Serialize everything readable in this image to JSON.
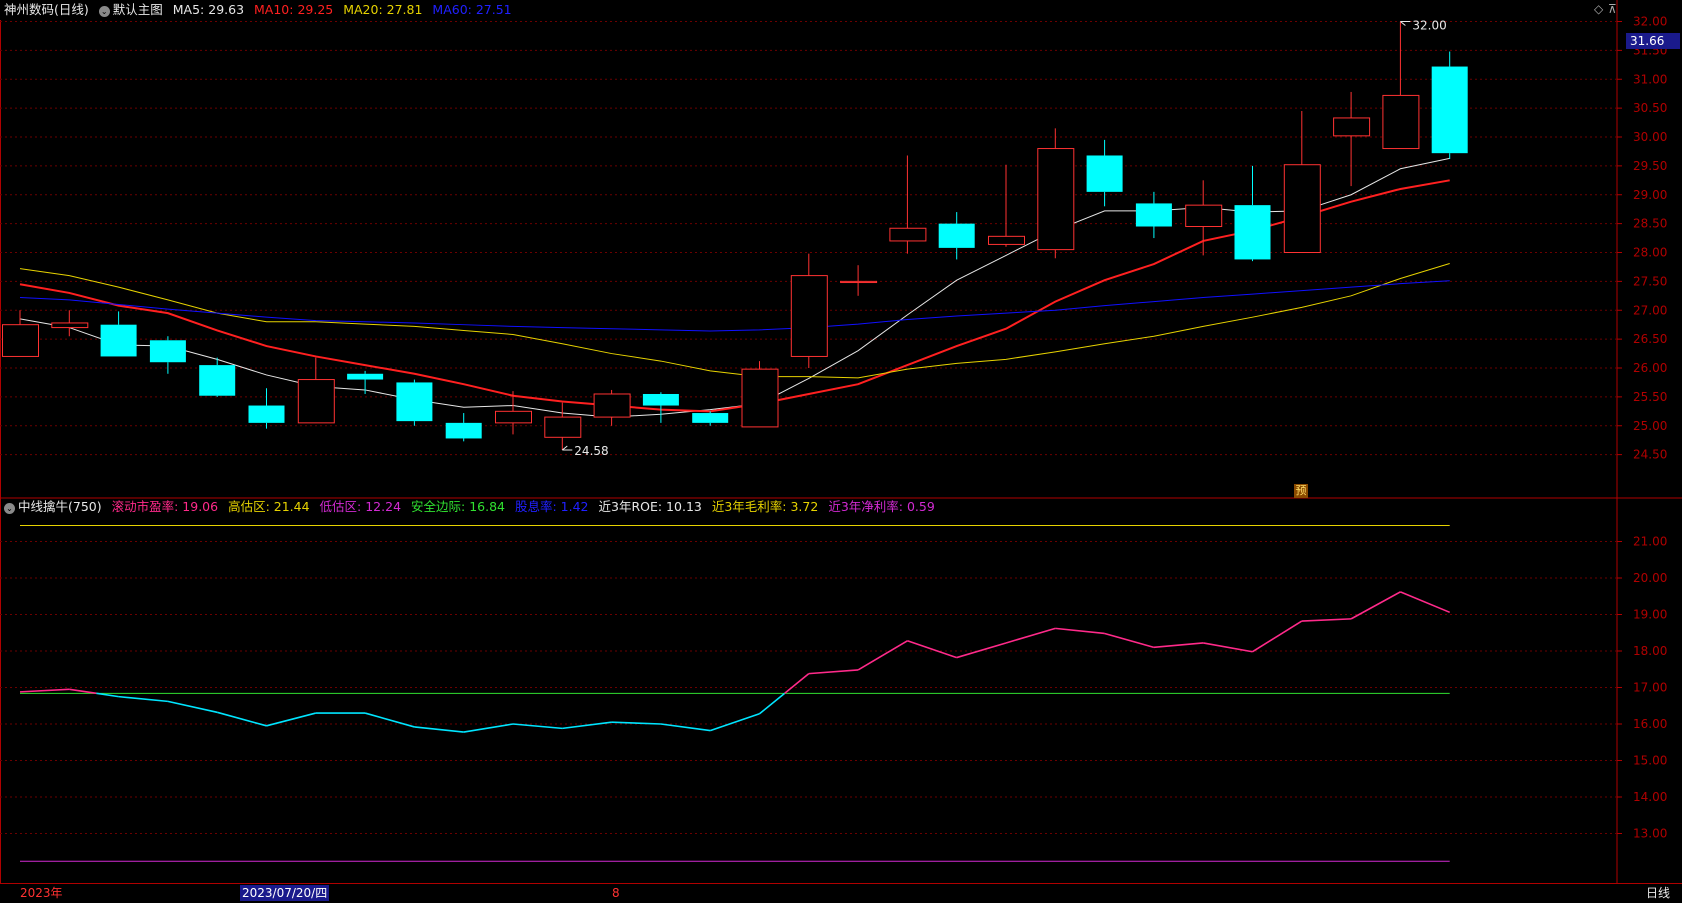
{
  "colors": {
    "grid": "#6b0000",
    "axis": "#b00000",
    "up": "#ff3232",
    "down": "#00ffff",
    "ma5": "#e6e6e6",
    "ma10": "#ff2020",
    "ma20": "#e6d200",
    "ma60": "#1010ff",
    "price_tag_bg": "#1a1a8c"
  },
  "main_header": {
    "stock_name": "神州数码",
    "period_label": "(日线)",
    "chart_menu_label": "默认主图",
    "ma5_label": "MA5: 29.63",
    "ma10_label": "MA10: 29.25",
    "ma20_label": "MA20: 27.81",
    "ma60_label": "MA60: 27.51"
  },
  "sub_header": {
    "indicator_label": "中线擒牛(750)",
    "pe_label": "滚动市盈率: 19.06",
    "high_label": "高估区: 21.44",
    "low_label": "低估区: 12.24",
    "safety_label": "安全边际: 16.84",
    "dividend_label": "股息率: 1.42",
    "roe_label": "近3年ROE: 10.13",
    "gross_label": "近3年毛利率: 3.72",
    "net_label": "近3年净利率: 0.59"
  },
  "bottom_bar": {
    "year_label": "2023年",
    "date_label": "2023/07/20/四",
    "month_label": "8",
    "period_button": "日线"
  },
  "main_axis_labels": [
    "32.00",
    "31.50",
    "31.00",
    "30.50",
    "30.00",
    "29.50",
    "29.00",
    "28.50",
    "28.00",
    "27.50",
    "27.00",
    "26.50",
    "26.00",
    "25.50",
    "25.00",
    "24.50"
  ],
  "sub_axis_labels": [
    "21.00",
    "20.00",
    "19.00",
    "18.00",
    "17.00",
    "16.00",
    "15.00",
    "14.00",
    "13.00"
  ],
  "current_price_tag": "31.66",
  "high_marker": "32.00",
  "low_marker": "24.58",
  "forecast_badge": "预",
  "chart_data": [
    {
      "type": "candlestick",
      "title": "神州数码 (日线)",
      "ylim": [
        24.2,
        32.2
      ],
      "candles": [
        {
          "o": 26.2,
          "h": 27.0,
          "l": 26.2,
          "c": 26.75
        },
        {
          "o": 26.7,
          "h": 27.0,
          "l": 26.55,
          "c": 26.78
        },
        {
          "o": 26.75,
          "h": 26.98,
          "l": 26.2,
          "c": 26.2
        },
        {
          "o": 26.48,
          "h": 26.55,
          "l": 25.9,
          "c": 26.1
        },
        {
          "o": 26.05,
          "h": 26.18,
          "l": 25.5,
          "c": 25.52
        },
        {
          "o": 25.35,
          "h": 25.65,
          "l": 24.95,
          "c": 25.05
        },
        {
          "o": 25.05,
          "h": 26.18,
          "l": 25.05,
          "c": 25.8
        },
        {
          "o": 25.9,
          "h": 25.95,
          "l": 25.55,
          "c": 25.8
        },
        {
          "o": 25.75,
          "h": 25.8,
          "l": 25.0,
          "c": 25.08
        },
        {
          "o": 25.05,
          "h": 25.22,
          "l": 24.73,
          "c": 24.78
        },
        {
          "o": 25.05,
          "h": 25.6,
          "l": 24.85,
          "c": 25.25
        },
        {
          "o": 24.8,
          "h": 25.4,
          "l": 24.58,
          "c": 25.15
        },
        {
          "o": 25.15,
          "h": 25.62,
          "l": 25.0,
          "c": 25.55
        },
        {
          "o": 25.55,
          "h": 25.58,
          "l": 25.05,
          "c": 25.35
        },
        {
          "o": 25.22,
          "h": 25.25,
          "l": 25.0,
          "c": 25.05
        },
        {
          "o": 24.98,
          "h": 26.12,
          "l": 24.98,
          "c": 25.98
        },
        {
          "o": 26.2,
          "h": 27.98,
          "l": 26.0,
          "c": 27.6
        },
        {
          "o": 27.48,
          "h": 27.78,
          "l": 27.25,
          "c": 27.5
        },
        {
          "o": 28.2,
          "h": 29.68,
          "l": 27.98,
          "c": 28.42
        },
        {
          "o": 28.5,
          "h": 28.7,
          "l": 27.88,
          "c": 28.08
        },
        {
          "o": 28.14,
          "h": 29.52,
          "l": 28.1,
          "c": 28.28
        },
        {
          "o": 28.05,
          "h": 30.15,
          "l": 27.9,
          "c": 29.8
        },
        {
          "o": 29.68,
          "h": 29.95,
          "l": 28.8,
          "c": 29.05
        },
        {
          "o": 28.85,
          "h": 29.05,
          "l": 28.25,
          "c": 28.45
        },
        {
          "o": 28.45,
          "h": 29.25,
          "l": 27.95,
          "c": 28.82
        },
        {
          "o": 28.82,
          "h": 29.5,
          "l": 27.85,
          "c": 27.88
        },
        {
          "o": 28.0,
          "h": 30.45,
          "l": 28.0,
          "c": 29.52
        },
        {
          "o": 30.02,
          "h": 30.78,
          "l": 29.15,
          "c": 30.33
        },
        {
          "o": 29.8,
          "h": 32.0,
          "l": 29.8,
          "c": 30.72
        },
        {
          "o": 31.22,
          "h": 31.48,
          "l": 29.62,
          "c": 29.72
        }
      ],
      "series": [
        {
          "name": "MA5",
          "values": [
            26.85,
            26.7,
            26.4,
            26.38,
            26.15,
            25.88,
            25.68,
            25.62,
            25.45,
            25.32,
            25.35,
            25.22,
            25.15,
            25.2,
            25.28,
            25.38,
            25.82,
            26.3,
            26.92,
            27.52,
            27.95,
            28.38,
            28.72,
            28.72,
            28.78,
            28.7,
            28.72,
            29.0,
            29.45,
            29.63
          ]
        },
        {
          "name": "MA10",
          "values": [
            27.45,
            27.3,
            27.08,
            26.95,
            26.65,
            26.38,
            26.2,
            26.05,
            25.9,
            25.72,
            25.52,
            25.42,
            25.35,
            25.28,
            25.25,
            25.38,
            25.55,
            25.72,
            26.05,
            26.38,
            26.68,
            27.15,
            27.52,
            27.8,
            28.2,
            28.38,
            28.62,
            28.88,
            29.1,
            29.25
          ]
        },
        {
          "name": "MA20",
          "values": [
            27.72,
            27.6,
            27.4,
            27.18,
            26.95,
            26.8,
            26.8,
            26.76,
            26.72,
            26.65,
            26.58,
            26.42,
            26.25,
            26.12,
            25.95,
            25.85,
            25.85,
            25.83,
            25.98,
            26.08,
            26.15,
            26.28,
            26.42,
            26.55,
            26.72,
            26.88,
            27.05,
            27.25,
            27.55,
            27.81
          ]
        },
        {
          "name": "MA60",
          "values": [
            27.22,
            27.18,
            27.1,
            27.02,
            26.95,
            26.88,
            26.82,
            26.8,
            26.78,
            26.75,
            26.72,
            26.7,
            26.68,
            26.66,
            26.64,
            26.66,
            26.7,
            26.76,
            26.84,
            26.9,
            26.95,
            27.0,
            27.08,
            27.15,
            27.22,
            27.28,
            27.34,
            27.4,
            27.46,
            27.51
          ]
        }
      ]
    },
    {
      "type": "line",
      "title": "中线擒牛(750)",
      "ylim": [
        12.2,
        21.8
      ],
      "series": [
        {
          "name": "滚动市盈率",
          "values": [
            16.88,
            16.95,
            16.75,
            16.62,
            16.32,
            15.95,
            16.3,
            16.3,
            15.92,
            15.78,
            16.0,
            15.88,
            16.05,
            16.0,
            15.82,
            16.28,
            17.38,
            17.48,
            18.28,
            17.82,
            18.22,
            18.62,
            18.48,
            18.1,
            18.22,
            17.98,
            18.82,
            18.88,
            19.62,
            19.06
          ]
        },
        {
          "name": "高估区",
          "values": [
            21.44
          ]
        },
        {
          "name": "低估区",
          "values": [
            12.24
          ]
        },
        {
          "name": "安全边际",
          "values": [
            16.84
          ]
        }
      ]
    }
  ]
}
